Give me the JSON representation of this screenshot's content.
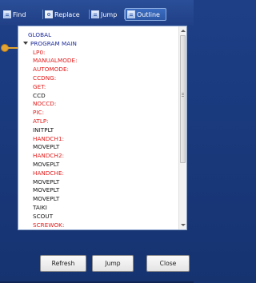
{
  "toolbar": {
    "tabs": [
      {
        "label": "Find",
        "icon": "find-icon"
      },
      {
        "label": "Replace",
        "icon": "replace-icon"
      },
      {
        "label": "Jump",
        "icon": "jump-icon"
      },
      {
        "label": "Outline",
        "icon": "outline-icon",
        "active": true
      }
    ]
  },
  "outline": {
    "nodes": [
      {
        "text": "GLOBAL",
        "kind": "root"
      },
      {
        "text": "PROGRAM MAIN",
        "kind": "program",
        "expanded": true
      },
      {
        "text": "LP0:",
        "kind": "label"
      },
      {
        "text": "MANUALMODE:",
        "kind": "label"
      },
      {
        "text": "AUTOMODE:",
        "kind": "label"
      },
      {
        "text": "CCDNG:",
        "kind": "label"
      },
      {
        "text": "GET:",
        "kind": "label"
      },
      {
        "text": "CCD",
        "kind": "statement"
      },
      {
        "text": "NOCCD:",
        "kind": "label"
      },
      {
        "text": "PIC:",
        "kind": "label"
      },
      {
        "text": "ATLP:",
        "kind": "label"
      },
      {
        "text": "INITPLT",
        "kind": "statement"
      },
      {
        "text": "HANDCH1:",
        "kind": "label"
      },
      {
        "text": "MOVEPLT",
        "kind": "statement"
      },
      {
        "text": "HANDCH2:",
        "kind": "label"
      },
      {
        "text": "MOVEPLT",
        "kind": "statement"
      },
      {
        "text": "HANDCHE:",
        "kind": "label"
      },
      {
        "text": "MOVEPLT",
        "kind": "statement"
      },
      {
        "text": "MOVEPLT",
        "kind": "statement"
      },
      {
        "text": "MOVEPLT",
        "kind": "statement"
      },
      {
        "text": "TAIKI",
        "kind": "statement"
      },
      {
        "text": "SCOUT",
        "kind": "statement"
      },
      {
        "text": "SCREWOK:",
        "kind": "label"
      }
    ]
  },
  "buttons": {
    "refresh": "Refresh",
    "jump": "Jump",
    "close": "Close"
  },
  "colors": {
    "background": "#1e3f86",
    "label_text": "#e21b1b",
    "program_text": "#1b2a9a",
    "statement_text": "#111111",
    "connector": "#e3a431"
  }
}
